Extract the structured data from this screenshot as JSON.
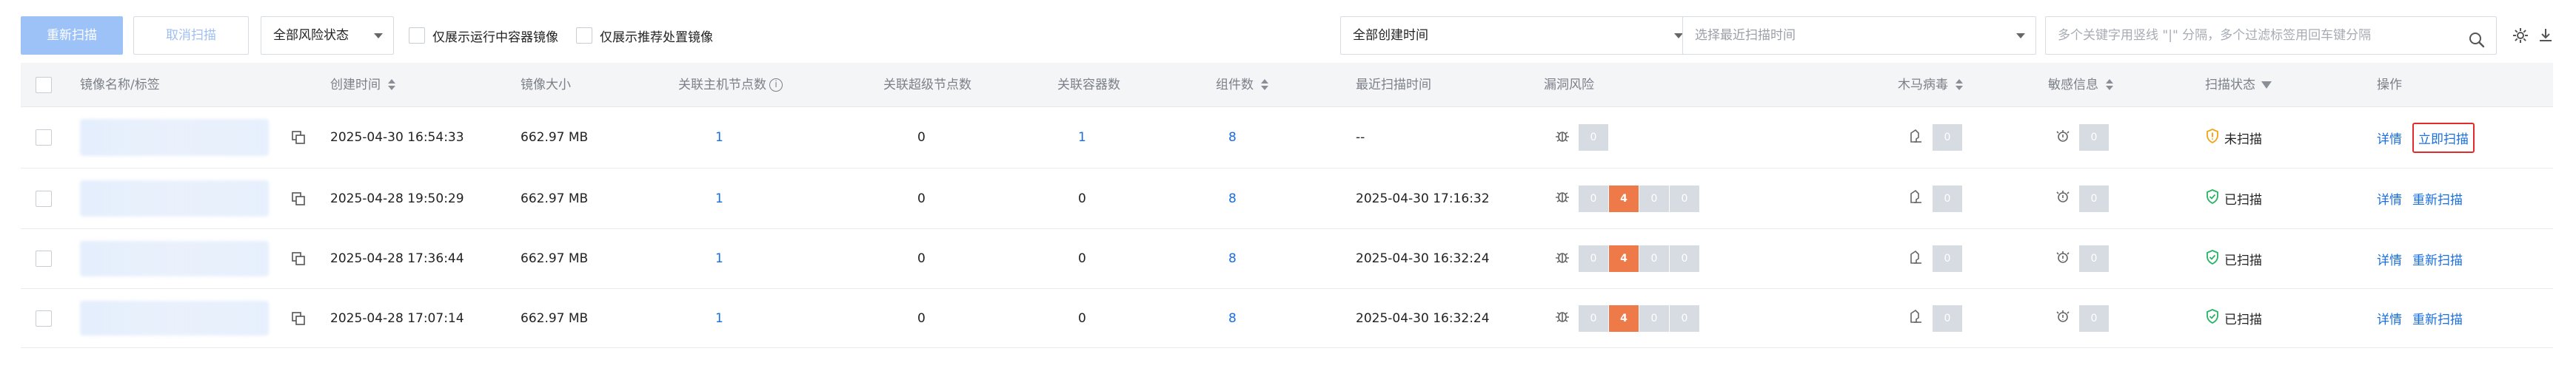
{
  "toolbar": {
    "rescan_label": "重新扫描",
    "cancel_scan_label": "取消扫描",
    "risk_select": "全部风险状态",
    "only_running_label": "仅展示运行中容器镜像",
    "only_recommended_label": "仅展示推荐处置镜像",
    "created_time_select": "全部创建时间",
    "last_scan_placeholder": "选择最近扫描时间",
    "search_placeholder": "多个关键字用竖线 \"|\" 分隔，多个过滤标签用回车键分隔"
  },
  "table": {
    "headers": {
      "name": "镜像名称/标签",
      "created": "创建时间",
      "size": "镜像大小",
      "host_nodes": "关联主机节点数",
      "super_nodes": "关联超级节点数",
      "containers": "关联容器数",
      "components": "组件数",
      "last_scan": "最近扫描时间",
      "vuln": "漏洞风险",
      "trojan": "木马病毒",
      "sensitive": "敏感信息",
      "scan_status": "扫描状态",
      "actions": "操作"
    },
    "rows": [
      {
        "created": "2025-04-30 16:54:33",
        "size": "662.97 MB",
        "host_nodes": "1",
        "super_nodes": "0",
        "containers": "1",
        "components": "8",
        "last_scan": "--",
        "vuln": [
          "0"
        ],
        "trojan": "0",
        "sensitive": "0",
        "status": "未扫描",
        "action_detail": "详情",
        "action_scan": "立即扫描"
      },
      {
        "created": "2025-04-28 19:50:29",
        "size": "662.97 MB",
        "host_nodes": "1",
        "super_nodes": "0",
        "containers": "0",
        "components": "8",
        "last_scan": "2025-04-30 17:16:32",
        "vuln": [
          "0",
          "4",
          "0",
          "0"
        ],
        "trojan": "0",
        "sensitive": "0",
        "status": "已扫描",
        "action_detail": "详情",
        "action_scan": "重新扫描"
      },
      {
        "created": "2025-04-28 17:36:44",
        "size": "662.97 MB",
        "host_nodes": "1",
        "super_nodes": "0",
        "containers": "0",
        "components": "8",
        "last_scan": "2025-04-30 16:32:24",
        "vuln": [
          "0",
          "4",
          "0",
          "0"
        ],
        "trojan": "0",
        "sensitive": "0",
        "status": "已扫描",
        "action_detail": "详情",
        "action_scan": "重新扫描"
      },
      {
        "created": "2025-04-28 17:07:14",
        "size": "662.97 MB",
        "host_nodes": "1",
        "super_nodes": "0",
        "containers": "0",
        "components": "8",
        "last_scan": "2025-04-30 16:32:24",
        "vuln": [
          "0",
          "4",
          "0",
          "0"
        ],
        "trojan": "0",
        "sensitive": "0",
        "status": "已扫描",
        "action_detail": "详情",
        "action_scan": "重新扫描"
      }
    ]
  },
  "colors": {
    "link": "#1a6fe0",
    "badge_grey": "#d7dbe2",
    "badge_orange": "#ee7a49",
    "status_ok": "#28b463",
    "status_warn": "#f2a51a",
    "highlight": "#e02c2c"
  },
  "icons": [
    "search-icon",
    "gear-icon",
    "download-icon",
    "copy-icon",
    "bug-icon",
    "trojan-icon",
    "sensitive-icon",
    "shield-check-icon",
    "shield-warning-icon",
    "filter-icon",
    "info-icon"
  ]
}
